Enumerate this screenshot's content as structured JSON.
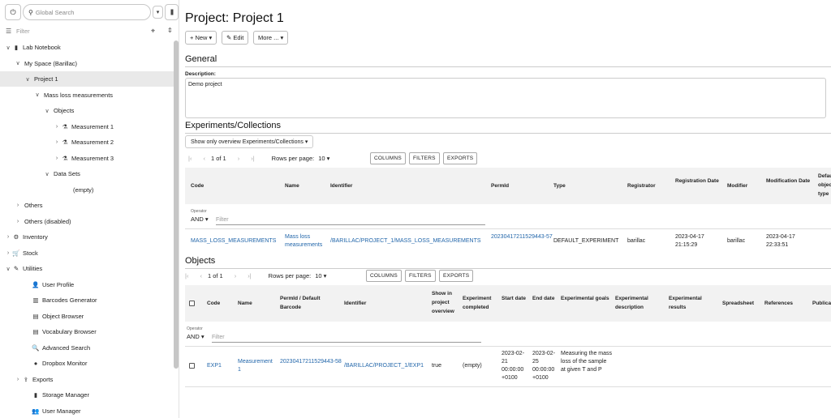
{
  "sidebar": {
    "power_icon": "⏻",
    "search_placeholder": "Global Search",
    "search_dropdown": "▾",
    "barcode_icon": "|||",
    "filter_placeholder": "Filter",
    "tree": [
      {
        "label": "Lab Notebook",
        "chevron": "∨",
        "icon": "▮",
        "indent": 0
      },
      {
        "label": "My Space (Barillac)",
        "chevron": "∨",
        "icon": "",
        "indent": 1
      },
      {
        "label": "Project 1",
        "chevron": "∨",
        "icon": "",
        "indent": 2,
        "selected": true
      },
      {
        "label": "Mass loss measurements",
        "chevron": "∨",
        "icon": "",
        "indent": 3
      },
      {
        "label": "Objects",
        "chevron": "∨",
        "icon": "",
        "indent": 4
      },
      {
        "label": "Measurement 1",
        "chevron": "›",
        "icon": "⚗",
        "indent": 5
      },
      {
        "label": "Measurement 2",
        "chevron": "›",
        "icon": "⚗",
        "indent": 5
      },
      {
        "label": "Measurement 3",
        "chevron": "›",
        "icon": "⚗",
        "indent": 5
      },
      {
        "label": "Data Sets",
        "chevron": "∨",
        "icon": "",
        "indent": 4
      },
      {
        "label": "(empty)",
        "chevron": "",
        "icon": "",
        "indent": 6
      },
      {
        "label": "Others",
        "chevron": "›",
        "icon": "",
        "indent": 1
      },
      {
        "label": "Others (disabled)",
        "chevron": "›",
        "icon": "",
        "indent": 1
      },
      {
        "label": "Inventory",
        "chevron": "›",
        "icon": "⚙",
        "indent": 0
      },
      {
        "label": "Stock",
        "chevron": "›",
        "icon": "🛒",
        "indent": 0
      },
      {
        "label": "Utilities",
        "chevron": "∨",
        "icon": "✎",
        "indent": 0
      },
      {
        "label": "User Profile",
        "chevron": "",
        "icon": "👤",
        "indent": 2
      },
      {
        "label": "Barcodes Generator",
        "chevron": "",
        "icon": "▥",
        "indent": 2
      },
      {
        "label": "Object Browser",
        "chevron": "",
        "icon": "▤",
        "indent": 2
      },
      {
        "label": "Vocabulary Browser",
        "chevron": "",
        "icon": "▤",
        "indent": 2
      },
      {
        "label": "Advanced Search",
        "chevron": "",
        "icon": "🔍",
        "indent": 2
      },
      {
        "label": "Dropbox Monitor",
        "chevron": "",
        "icon": "●",
        "indent": 2
      },
      {
        "label": "Exports",
        "chevron": "›",
        "icon": "⇪",
        "indent": 1
      },
      {
        "label": "Storage Manager",
        "chevron": "",
        "icon": "▮",
        "indent": 2
      },
      {
        "label": "User Manager",
        "chevron": "",
        "icon": "👥",
        "indent": 2
      }
    ]
  },
  "main": {
    "title": "Project: Project 1",
    "toolbar": {
      "new": "+ New ▾",
      "edit": "✎ Edit",
      "more": "More ... ▾"
    },
    "general": {
      "heading": "General",
      "description_label": "Description:",
      "description_value": "Demo project"
    },
    "experiments": {
      "heading": "Experiments/Collections",
      "overview_select": "Show only overview Experiments/Collections ▾",
      "pager": {
        "first": "|‹",
        "prev": "‹",
        "page": "1 of 1",
        "next": "›",
        "last": "›|",
        "rows_label": "Rows per page:",
        "rows_value": "10 ▾"
      },
      "buttons": {
        "columns": "COLUMNS",
        "filters": "FILTERS",
        "exports": "EXPORTS"
      },
      "columns": [
        "Code",
        "Name",
        "Identifier",
        "PermId",
        "Type",
        "Registrator",
        "Registration Date",
        "Modifier",
        "Modification Date",
        "Default object type"
      ],
      "operator_label": "Operator",
      "operator_value": "AND ▾",
      "filter_placeholder": "Filter",
      "row": {
        "code": "MASS_LOSS_MEASUREMENTS",
        "name": "Mass loss measurements",
        "identifier": "/BARILLAC/PROJECT_1/MASS_LOSS_MEASUREMENTS",
        "permid": "20230417211529443-57",
        "type": "DEFAULT_EXPERIMENT",
        "registrator": "barillac",
        "registration_date": "2023-04-17 21:15:29",
        "modifier": "barillac",
        "modification_date": "2023-04-17 22:33:51"
      }
    },
    "objects": {
      "heading": "Objects",
      "pager": {
        "first": "|‹",
        "prev": "‹",
        "page": "1 of 1",
        "next": "›",
        "last": "›|",
        "rows_label": "Rows per page:",
        "rows_value": "10 ▾"
      },
      "buttons": {
        "columns": "COLUMNS",
        "filters": "FILTERS",
        "exports": "EXPORTS"
      },
      "columns": [
        "Code",
        "Name",
        "PermId / Default Barcode",
        "Identifier",
        "Show in project overview",
        "Experiment completed",
        "Start date",
        "End date",
        "Experimental goals",
        "Experimental description",
        "Experimental results",
        "Spreadsheet",
        "References",
        "Publication"
      ],
      "operator_label": "Operator",
      "operator_value": "AND ▾",
      "filter_placeholder": "Filter",
      "row": {
        "code": "EXP1",
        "name": "Measurement 1",
        "permid": "20230417211529443-58",
        "identifier": "/BARILLAC/PROJECT_1/EXP1",
        "show_overview": "true",
        "completed": "(empty)",
        "start_date": "2023-02-21 00:00:00 +0100",
        "end_date": "2023-02-25 00:00:00 +0100",
        "goals": "Measuring the mass loss of the sample at given T and P"
      }
    }
  }
}
